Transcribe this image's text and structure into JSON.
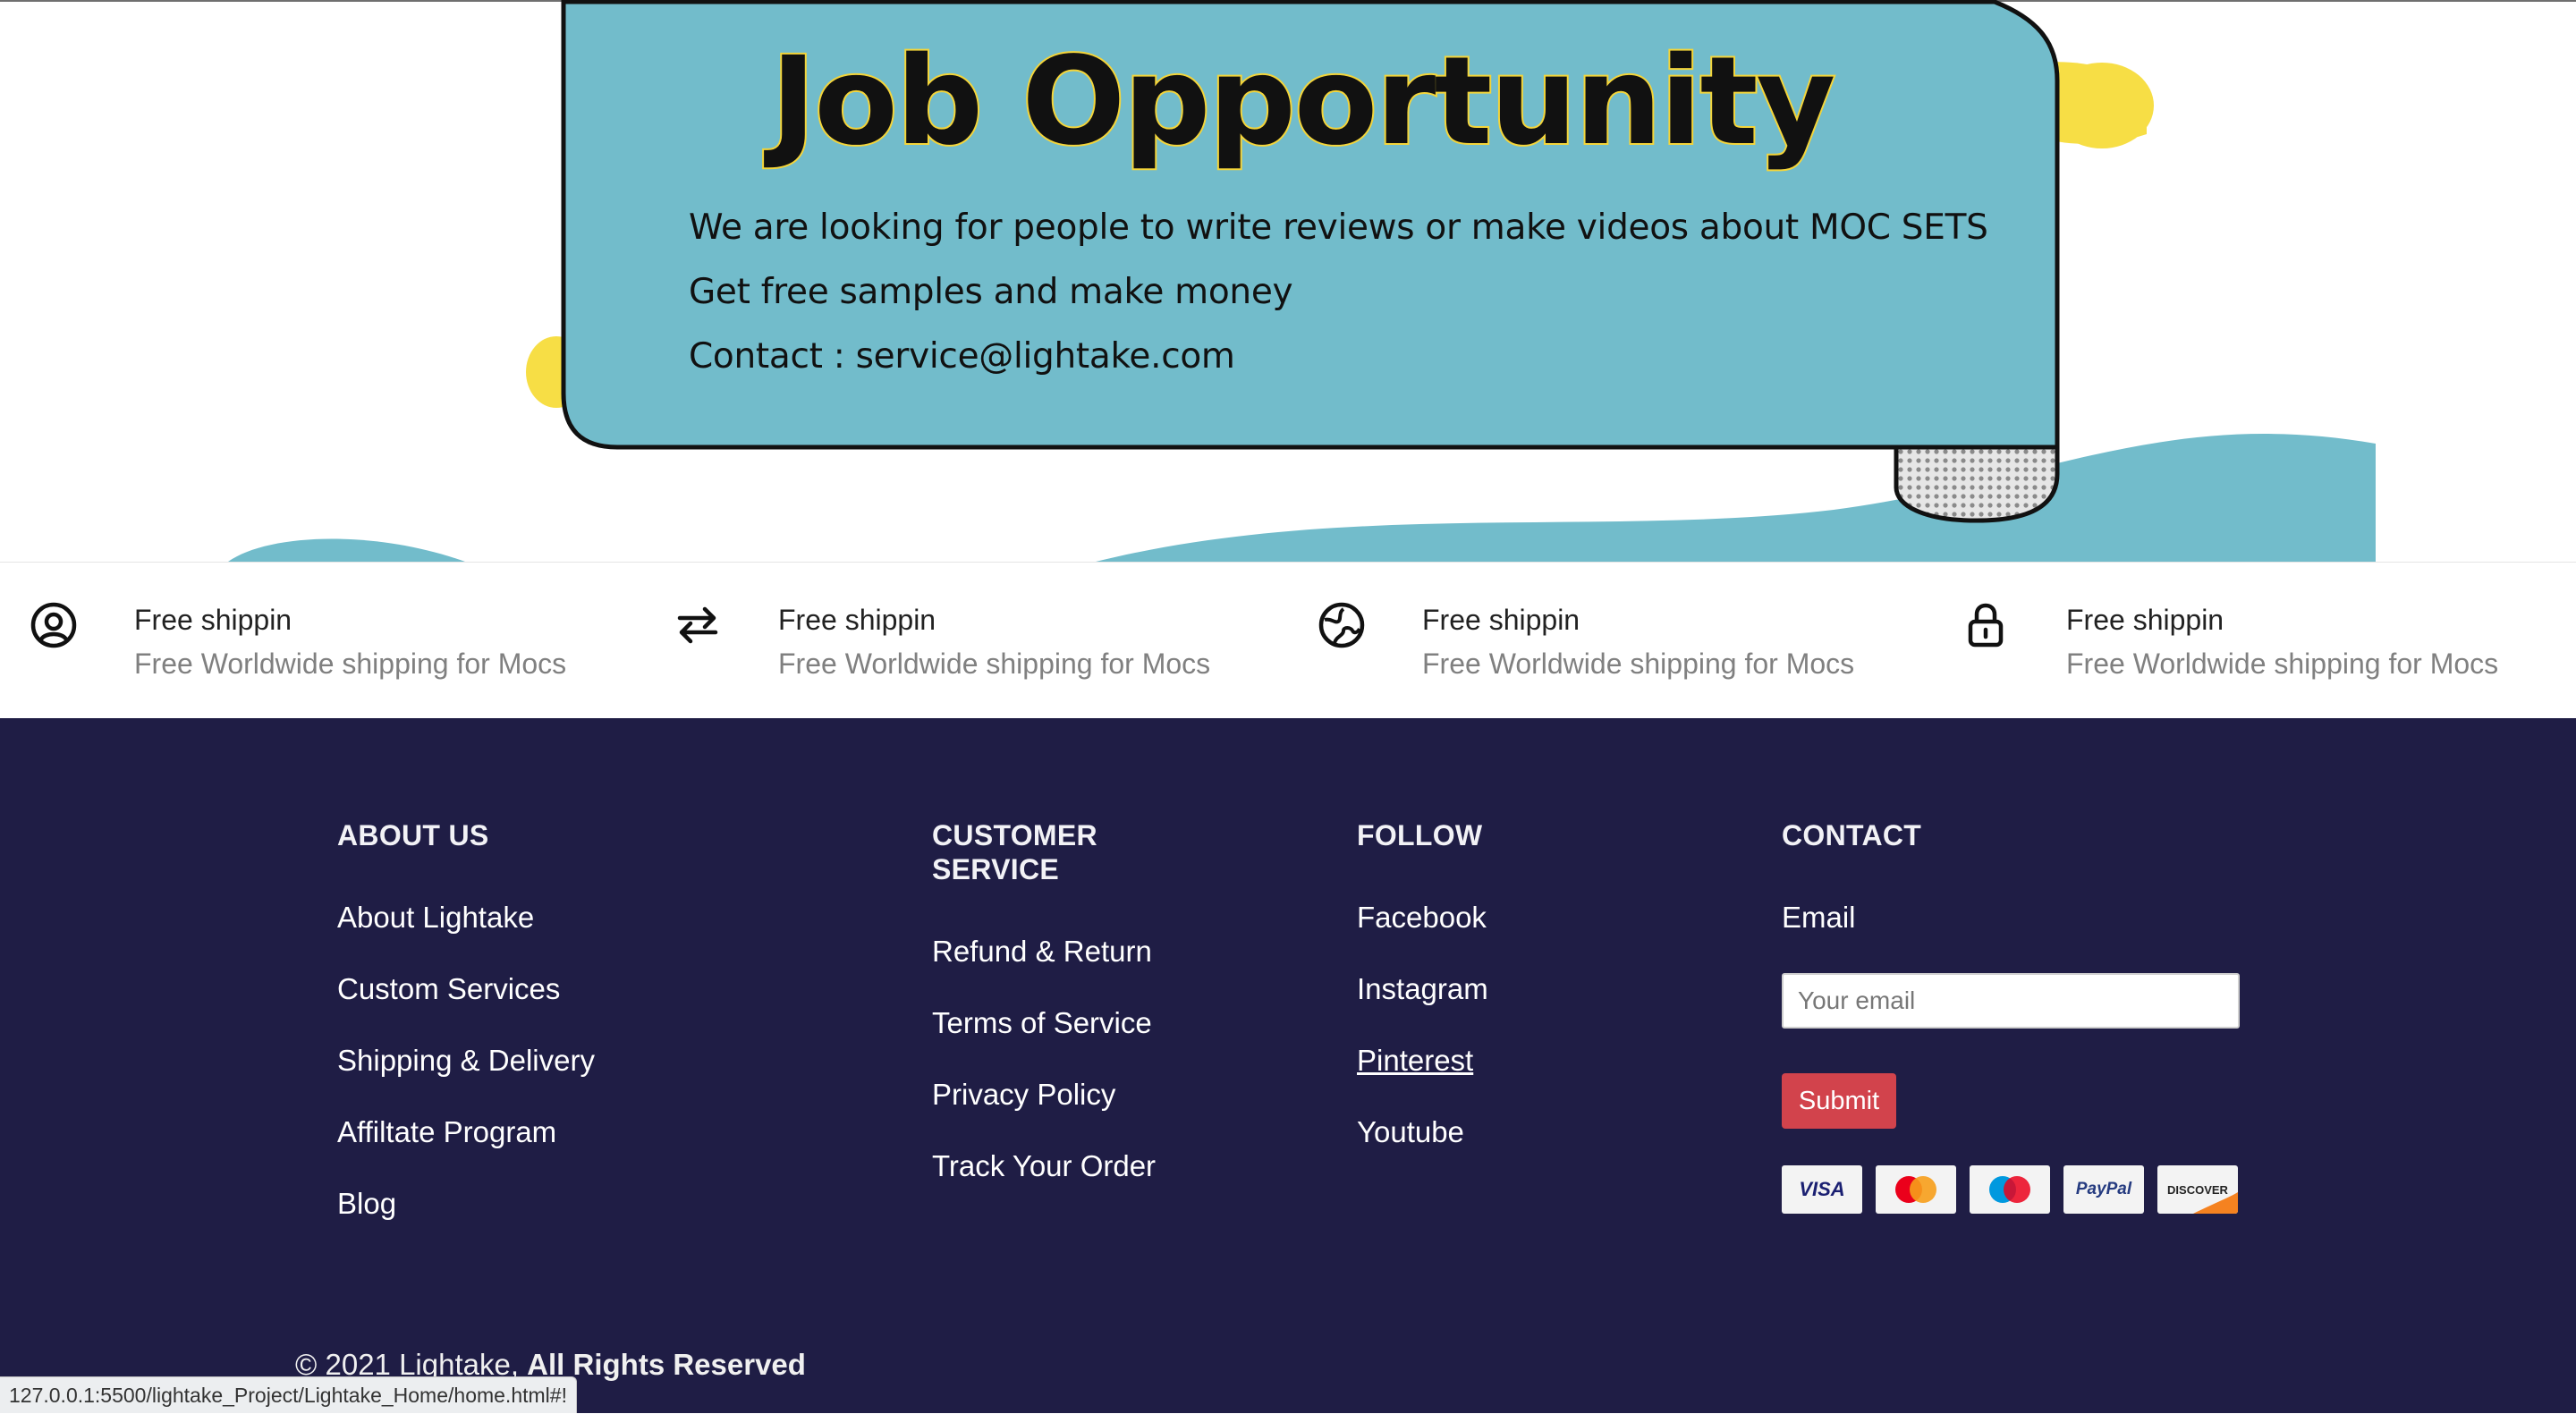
{
  "banner": {
    "title": "Job Opportunity",
    "line1": "We are looking for people to write reviews or make videos about MOC SETS",
    "line2": "Get free samples and make money",
    "line3": "Contact : service@lightake.com"
  },
  "features": [
    {
      "icon": "user-circle-icon",
      "title": "Free shippin",
      "desc": "Free Worldwide shipping for Mocs"
    },
    {
      "icon": "exchange-arrows-icon",
      "title": "Free shippin",
      "desc": "Free Worldwide shipping for Mocs"
    },
    {
      "icon": "globe-icon",
      "title": "Free shippin",
      "desc": "Free Worldwide shipping for Mocs"
    },
    {
      "icon": "lock-icon",
      "title": "Free shippin",
      "desc": "Free Worldwide shipping for Mocs"
    }
  ],
  "footer": {
    "about": {
      "heading": "ABOUT US",
      "links": [
        "About Lightake",
        "Custom Services",
        "Shipping & Delivery",
        "Affiltate Program",
        "Blog"
      ]
    },
    "service": {
      "heading_line1": "CUSTOMER",
      "heading_line2": "SERVICE",
      "links": [
        "Refund & Return",
        "Terms of Service",
        "Privacy Policy",
        "Track Your Order"
      ]
    },
    "follow": {
      "heading": "FOLLOW",
      "links": [
        "Facebook",
        "Instagram",
        "Pinterest",
        "Youtube"
      ]
    },
    "contact": {
      "heading": "CONTACT",
      "email_label": "Email",
      "email_placeholder": "Your email",
      "submit_label": "Submit",
      "payment_cards": [
        "VISA",
        "MasterCard",
        "Maestro",
        "PayPal",
        "DISCOVER"
      ]
    },
    "copyright_prefix": "© 2021 Lightake,",
    "copyright_strong": "All Rights Reserved"
  },
  "status_bar": {
    "url": "127.0.0.1:5500/lightake_Project/Lightake_Home/home.html#!"
  },
  "colors": {
    "banner_teal": "#72bccb",
    "banner_yellow": "#f7de45",
    "footer_bg": "#1f1d45",
    "submit_red": "#d2434c"
  }
}
